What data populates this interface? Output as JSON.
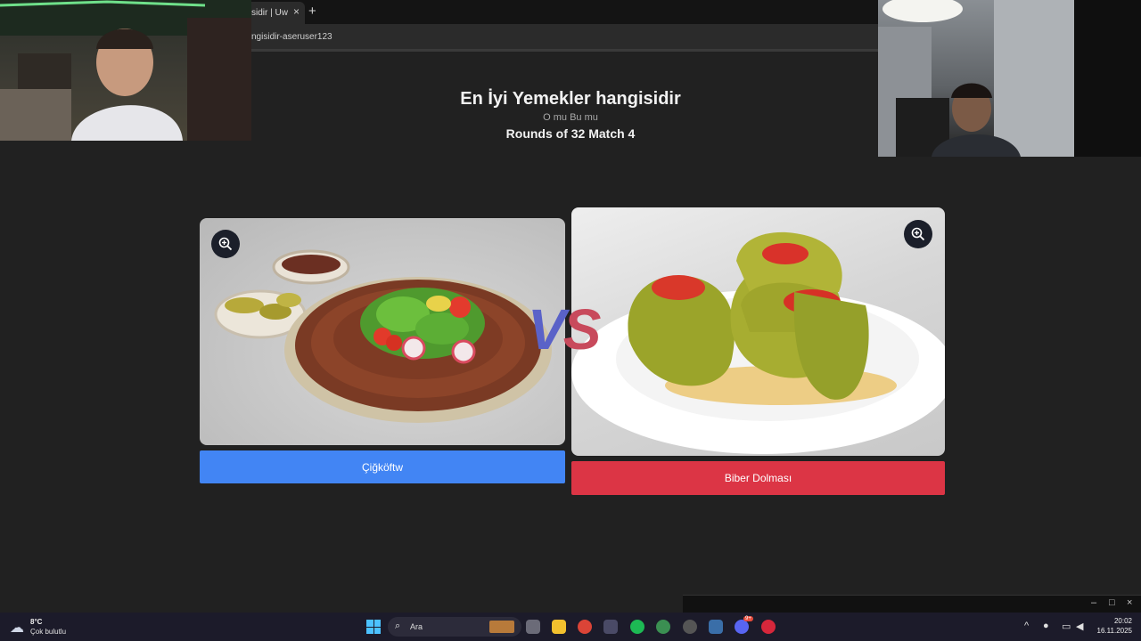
{
  "browser": {
    "tab_title": "sidir | Uw",
    "tab_close": "×",
    "new_tab": "+",
    "address": "ngisidir-aseruser123"
  },
  "page": {
    "title": "En İyi Yemekler hangisidir",
    "subtitle": "O mu Bu mu",
    "round_info": "Rounds of 32 Match 4",
    "vs_v": "V",
    "vs_s": "S"
  },
  "choices": {
    "left_label": "Çiğköftw",
    "right_label": "Biber Dolması"
  },
  "colors": {
    "left_button": "#4285f4",
    "right_button": "#dc3545"
  },
  "mini_window": {
    "minimize": "–",
    "maximize": "□",
    "close": "×"
  },
  "taskbar": {
    "weather_temp": "8°C",
    "weather_desc": "Çok bulutlu",
    "search_placeholder": "Ara",
    "time": "20:02",
    "date": "16.11.2025",
    "discord_badge": "9+"
  }
}
